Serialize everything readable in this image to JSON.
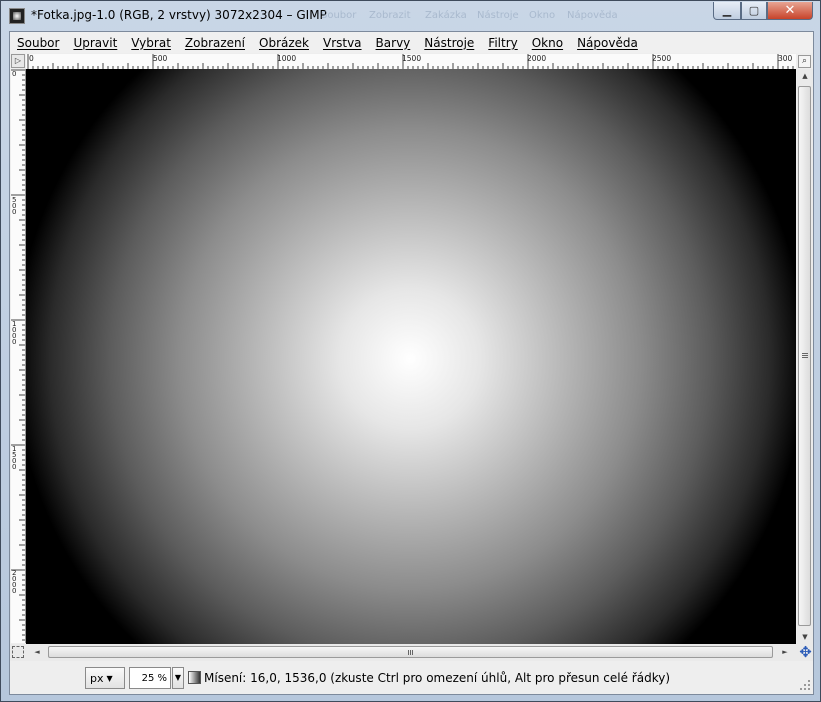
{
  "window": {
    "title": "*Fotka.jpg-1.0 (RGB, 2 vrstvy) 3072x2304 – GIMP",
    "ghost_menu": [
      "Soubor",
      "Zobrazit",
      "Zakázka",
      "Nástroje",
      "Okno",
      "Nápověda"
    ],
    "minimize_label": "▁",
    "maximize_label": "▢",
    "close_label": "✕"
  },
  "menubar": {
    "items": [
      "Soubor",
      "Upravit",
      "Vybrat",
      "Zobrazení",
      "Obrázek",
      "Vrstva",
      "Barvy",
      "Nástroje",
      "Filtry",
      "Okno",
      "Nápověda"
    ]
  },
  "rulers": {
    "corner_label": "▷",
    "horizontal_labels": [
      "0",
      "500",
      "1000",
      "1500",
      "2000",
      "2500",
      "300"
    ],
    "vertical_labels": [
      "0",
      "500",
      "1000",
      "1500",
      "2000"
    ]
  },
  "scroll": {
    "up_arrow": "▲",
    "down_arrow": "▼",
    "left_arrow": "◄",
    "right_arrow": "►",
    "navigate_icon": "✥",
    "zoom_fit_icon": "⌕"
  },
  "statusbar": {
    "unit": "px",
    "unit_caret": "▼",
    "zoom": "25 %",
    "zoom_caret": "▼",
    "message": "Mísení: 16,0, 1536,0 (zkuste Ctrl pro omezení úhlů, Alt pro přesun celé řádky)"
  },
  "colors": {
    "title_bar": "#c9d6e6",
    "close_button": "#c7432a",
    "canvas_background": "#000000",
    "gradient_center": "#ffffff"
  },
  "icons": [
    "app-icon",
    "minimize-icon",
    "maximize-icon",
    "close-icon",
    "quickmask-icon",
    "navigate-icon",
    "zoom-fit-icon",
    "blend-tool-icon",
    "resize-grip-icon"
  ]
}
